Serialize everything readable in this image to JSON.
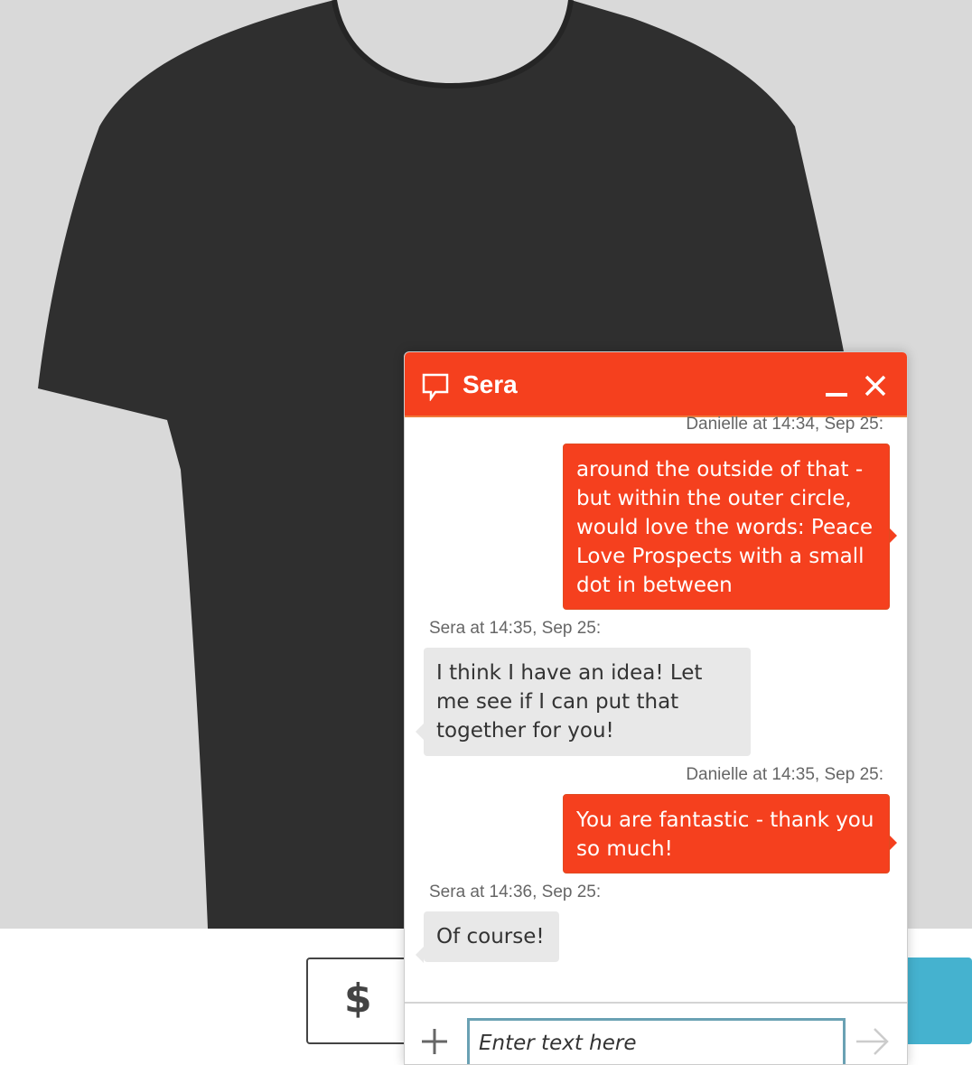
{
  "product": {
    "price_symbol": "$"
  },
  "chat": {
    "title": "Sera",
    "messages": [
      {
        "meta": "Danielle at 14:34, Sep 25:",
        "text": "around the outside of that - but within the outer circle, would love the words: Peace Love Prospects with a small dot in between",
        "side": "mine"
      },
      {
        "meta": "Sera at 14:35, Sep 25:",
        "text": "I think I have an idea! Let me see if I can put that together for you!",
        "side": "theirs"
      },
      {
        "meta": "Danielle at 14:35, Sep 25:",
        "text": "You are fantastic - thank you so much!",
        "side": "mine"
      },
      {
        "meta": "Sera at 14:36, Sep 25:",
        "text": "Of course!",
        "side": "theirs"
      }
    ],
    "input_placeholder": "Enter text here"
  },
  "colors": {
    "accent": "#f5401e",
    "bubble_theirs": "#e8e8e8",
    "checkout": "#45b2cf"
  }
}
